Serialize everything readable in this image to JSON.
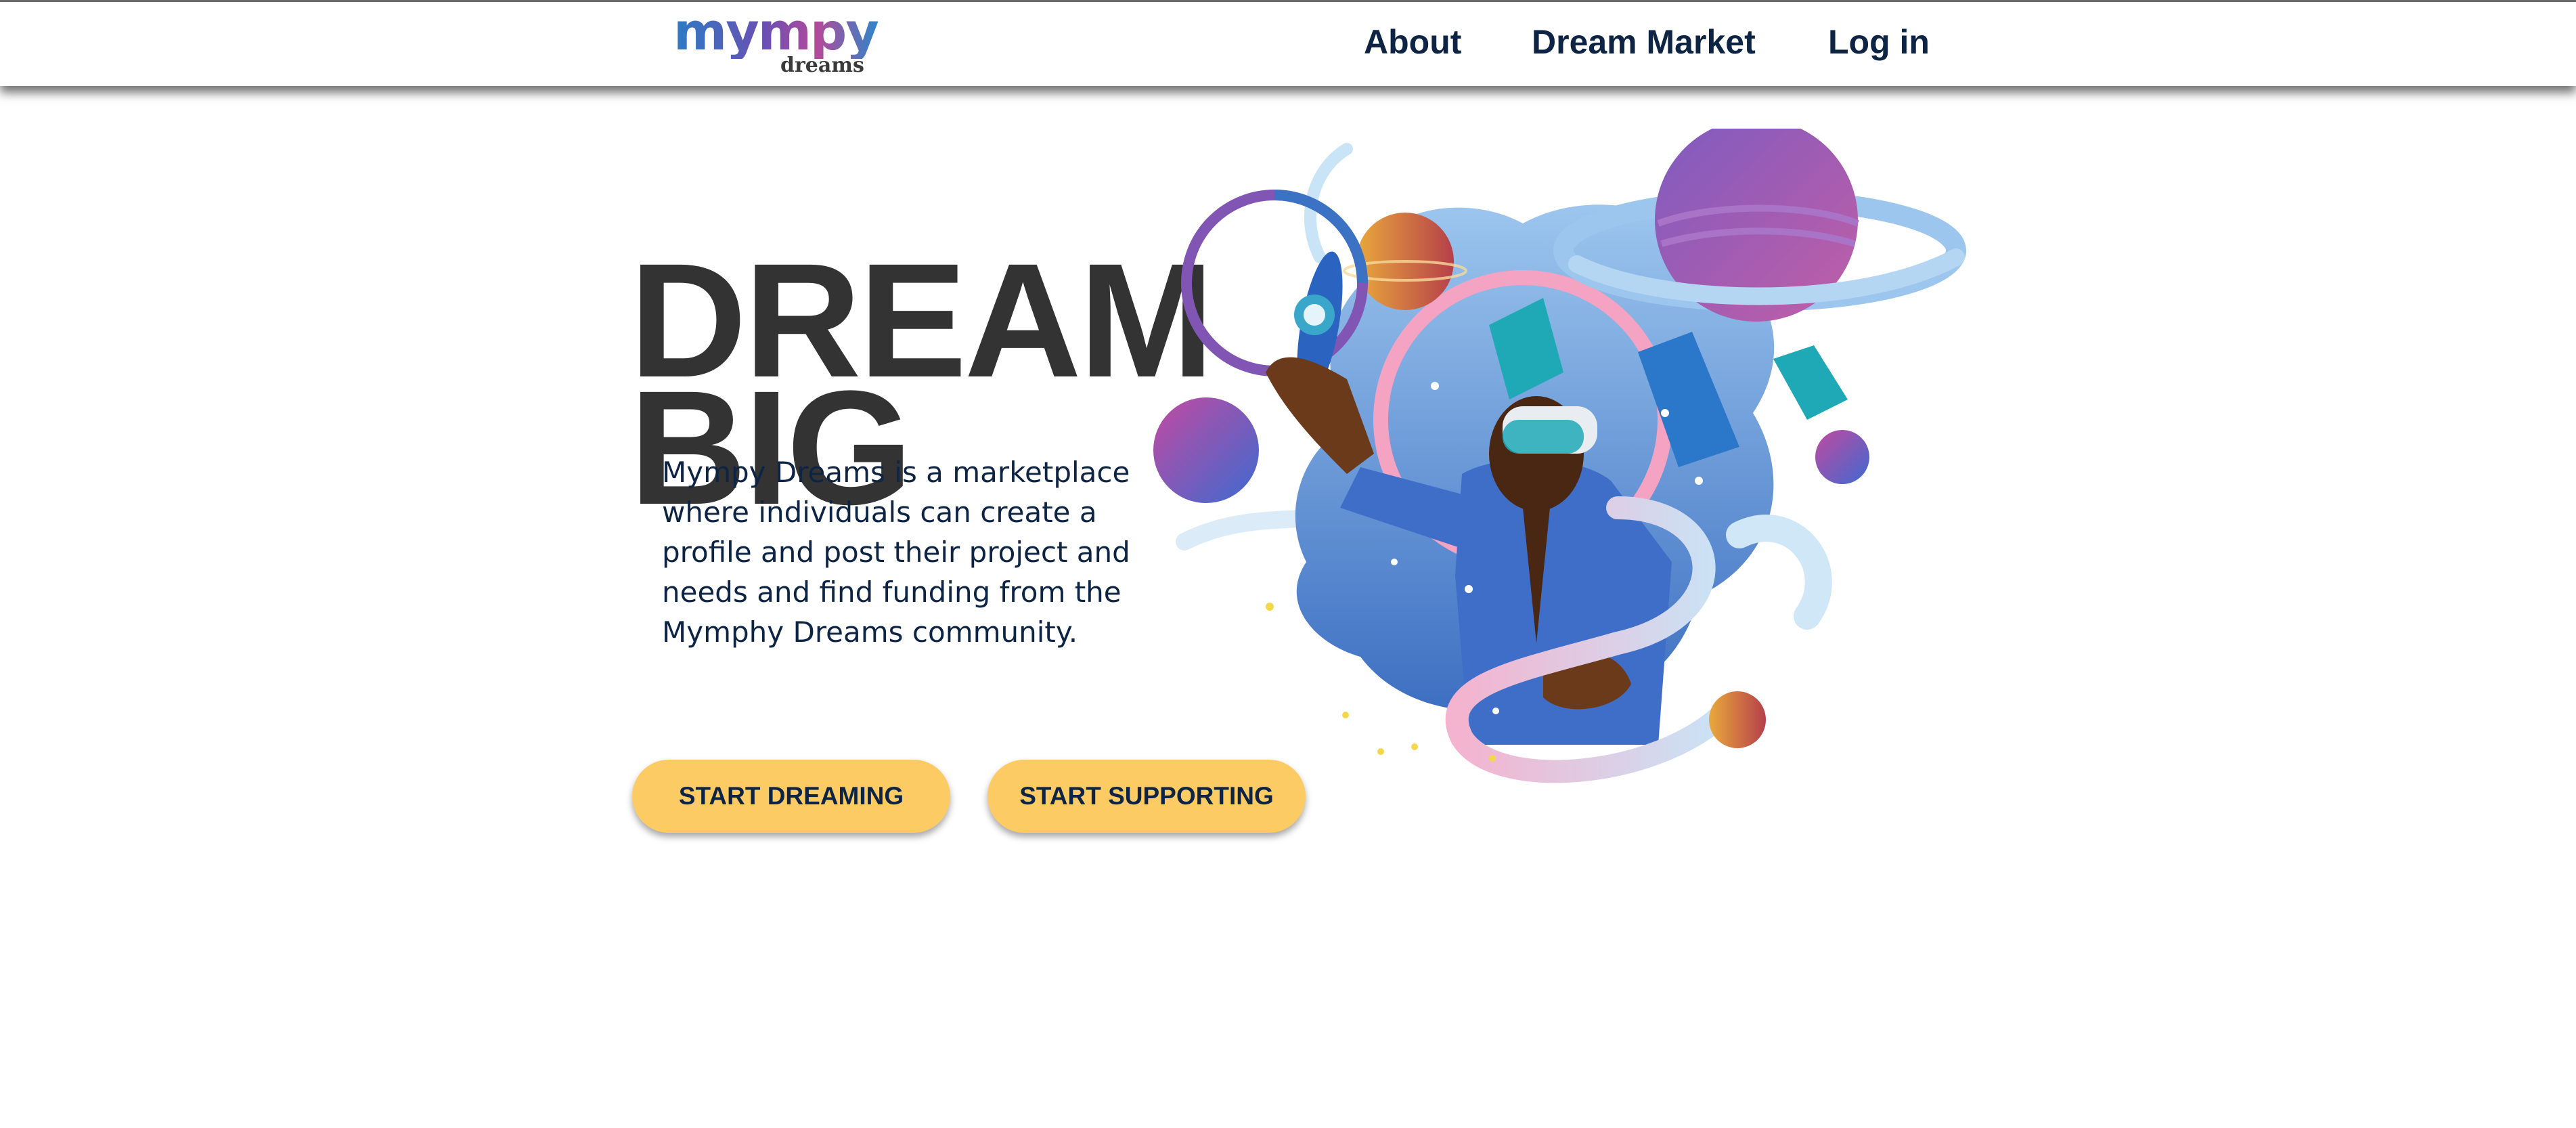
{
  "header": {
    "logo_text": "mympy",
    "logo_subtext": "dreams",
    "nav": {
      "about": "About",
      "dream_market": "Dream Market",
      "login": "Log in"
    }
  },
  "hero": {
    "title_line1": "DREAM",
    "title_line2": "BIG",
    "description": "Mympy Dreams is a marketplace where individuals can create a profile and post their project and needs and find funding from the Mymphy Dreams community.",
    "buttons": {
      "start_dreaming": "START DREAMING",
      "start_supporting": "START SUPPORTING"
    }
  },
  "colors": {
    "nav_text": "#0e2444",
    "title_text": "#333333",
    "button_bg": "#fdcb64",
    "logo_gradient_start": "#2c7bc4",
    "logo_gradient_end": "#b24a9a"
  },
  "illustration": {
    "icon": "vr-dreamer-planets-illustration"
  }
}
